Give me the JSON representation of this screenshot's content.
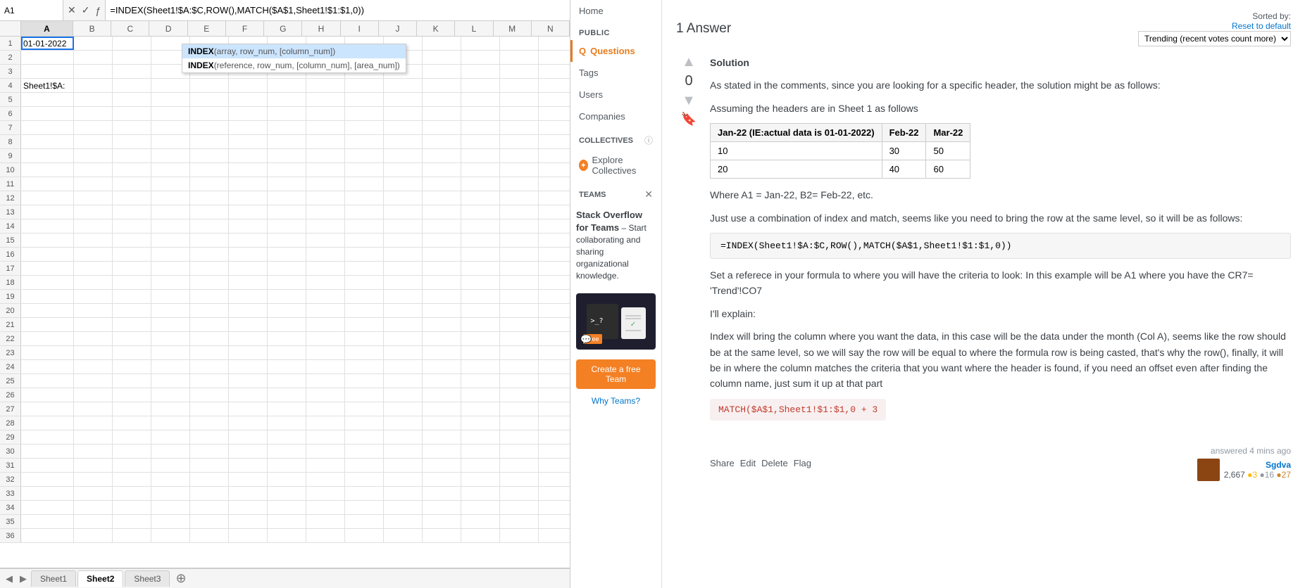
{
  "spreadsheet": {
    "name_box": "A1",
    "formula": "=INDEX(Sheet1!$A:$C,ROW(),MATCH($A$1,Sheet1!$1:$1,0))",
    "autocomplete": {
      "items": [
        {
          "syntax": "INDEX(array, row_num, [column_num])",
          "selected": true
        },
        {
          "syntax": "INDEX(reference, row_num, [column_num], [area_num])",
          "selected": false
        }
      ]
    },
    "columns": [
      "A",
      "B",
      "C",
      "D",
      "E",
      "F",
      "G",
      "H",
      "I",
      "J",
      "K",
      "L",
      "M",
      "N"
    ],
    "cells": {
      "A1": "01-01-2022",
      "A4": "Sheet1!$A:"
    },
    "rows": 36,
    "sheets": [
      {
        "name": "Sheet1",
        "active": false
      },
      {
        "name": "Sheet2",
        "active": true
      },
      {
        "name": "Sheet3",
        "active": false
      }
    ]
  },
  "sidebar": {
    "items": [
      {
        "label": "Home"
      },
      {
        "label": "Questions",
        "active": true
      },
      {
        "label": "Tags"
      },
      {
        "label": "Users"
      },
      {
        "label": "Companies"
      }
    ],
    "public_label": "PUBLIC",
    "collectives_label": "COLLECTIVES",
    "explore_collectives": "Explore Collectives",
    "teams_label": "TEAMS",
    "teams_promo_title": "Stack Overflow for Teams",
    "teams_promo_dash": "–",
    "teams_promo_text": "Start collaborating and sharing organizational knowledge.",
    "create_team_btn": "Create a free Team",
    "why_teams": "Why Teams?"
  },
  "answer": {
    "title": "1 Answer",
    "sorted_by_label": "Sorted by:",
    "reset_label": "Reset to default",
    "sort_option": "Trending (recent votes count more)",
    "vote_count": "0",
    "solution_heading": "Solution",
    "paragraphs": {
      "p1": "As stated in the comments, since you are looking for a specific header, the solution might be as follows:",
      "p2": "Assuming the headers are in Sheet 1 as follows",
      "p3": "Where A1 = Jan-22, B2= Feb-22, etc.",
      "p4": "Just use a combination of index and match, seems like you need to bring the row at the same level, so it will be as follows:",
      "p5": "Set a referece in your formula to where you will have the criteria to look: In this example will be A1 where you have the CR7= 'Trend'!CO7",
      "p6": "I'll explain:",
      "p7_start": "Index will bring the column where you want the data, in this case will be the data under the month (Col A), seems like the row should be at the same level, so we will say the row will be equal to where the formula row is being casted, that's why the row(), finally, it will be in where the column matches the criteria that you want where the header is found, if you need an offset even after finding the column name, just sum it up at that part"
    },
    "code1": "=INDEX(Sheet1!$A:$C,ROW(),MATCH($A$1,Sheet1!$1:$1,0))",
    "code2": "MATCH($A$1,Sheet1!$1:$1,0 + 3",
    "table": {
      "headers": [
        "Jan-22 (IE:actual data is 01-01-2022)",
        "Feb-22",
        "Mar-22"
      ],
      "rows": [
        [
          "10",
          "30",
          "50"
        ],
        [
          "20",
          "40",
          "60"
        ]
      ]
    },
    "actions": [
      "Share",
      "Edit",
      "Delete",
      "Flag"
    ],
    "answered_label": "answered 4 mins ago",
    "user": {
      "name": "Sgdva",
      "rep": "2,667",
      "gold": "3",
      "silver": "16",
      "bronze": "27"
    }
  }
}
